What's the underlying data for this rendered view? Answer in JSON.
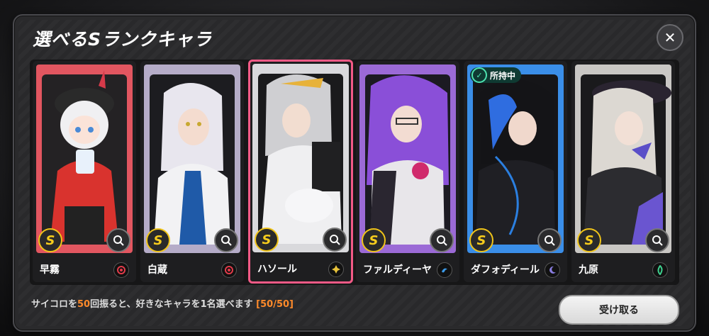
{
  "dialog": {
    "title": "選べるSランクキャラ",
    "close_label": "✕"
  },
  "cards": [
    {
      "name": "早霧",
      "rank": "S",
      "bg": "#e25660",
      "owned": false,
      "element_color": "#e23b4a",
      "element_icon": "fire-element-icon"
    },
    {
      "name": "白蔵",
      "rank": "S",
      "bg": "#b5acc8",
      "owned": false,
      "element_color": "#e23b4a",
      "element_icon": "fire-element-icon"
    },
    {
      "name": "ハソール",
      "rank": "S",
      "bg": "#d9d9dc",
      "owned": false,
      "element_color": "#e8c23a",
      "element_icon": "light-element-icon"
    },
    {
      "name": "ファルディーヤ",
      "rank": "S",
      "bg": "#9b6ad6",
      "owned": false,
      "element_color": "#3b9ae8",
      "element_icon": "water-element-icon"
    },
    {
      "name": "ダフォディール",
      "rank": "S",
      "bg": "#3a8ee8",
      "owned": true,
      "owned_label": "所持中",
      "element_color": "#8a7de0",
      "element_icon": "dark-element-icon"
    },
    {
      "name": "九原",
      "rank": "S",
      "bg": "#c9c7c4",
      "owned": false,
      "element_color": "#3ecf8e",
      "element_icon": "wind-element-icon"
    }
  ],
  "footer": {
    "text_before": "サイコロを",
    "count": "50",
    "text_after": "回振ると、好きなキャラを1名選べます ",
    "progress": "[50/50]"
  },
  "receive_button": "受け取る",
  "colors": {
    "accent_pink": "#f25a86",
    "highlight_orange": "#ff8a2a",
    "rank_gold": "#f6cc1d"
  }
}
